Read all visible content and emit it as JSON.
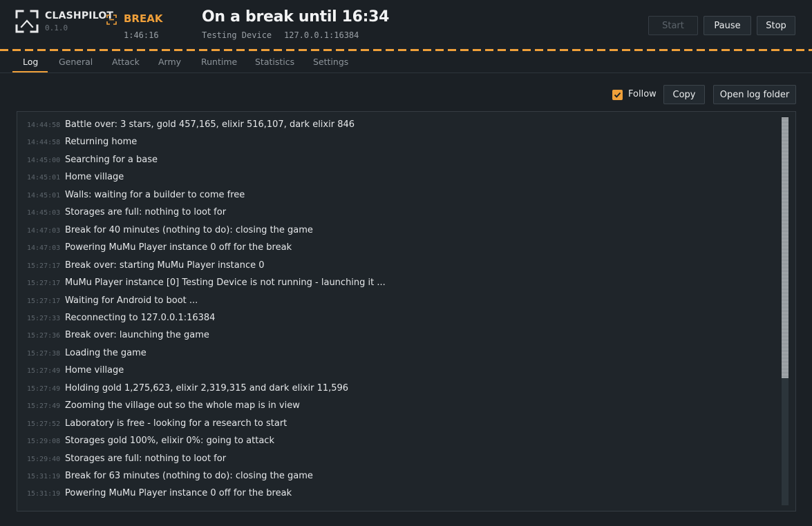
{
  "app": {
    "name": "CLASHPILOT",
    "version": "0.1.0"
  },
  "state": {
    "label": "BREAK",
    "timer": "1:46:16",
    "color": "#f0a03a"
  },
  "headline": "On a break until 16:34",
  "device": {
    "name": "Testing Device",
    "address": "127.0.0.1:16384"
  },
  "controls": {
    "start": "Start",
    "pause": "Pause",
    "stop": "Stop"
  },
  "tabs": [
    "Log",
    "General",
    "Attack",
    "Army",
    "Runtime",
    "Statistics",
    "Settings"
  ],
  "active_tab": "Log",
  "log_toolbar": {
    "follow_label": "Follow",
    "follow_checked": true,
    "copy": "Copy",
    "open_folder": "Open log folder"
  },
  "log": [
    {
      "time": "14:44:58",
      "message": "Battle over: 3 stars, gold 457,165, elixir 516,107, dark elixir 846"
    },
    {
      "time": "14:44:58",
      "message": "Returning home"
    },
    {
      "time": "14:45:00",
      "message": "Searching for a base"
    },
    {
      "time": "14:45:01",
      "message": "Home village"
    },
    {
      "time": "14:45:01",
      "message": "Walls: waiting for a builder to come free"
    },
    {
      "time": "14:45:03",
      "message": "Storages are full: nothing to loot for"
    },
    {
      "time": "14:47:03",
      "message": "Break for 40 minutes (nothing to do): closing the game"
    },
    {
      "time": "14:47:03",
      "message": "Powering MuMu Player instance 0 off for the break"
    },
    {
      "time": "15:27:17",
      "message": "Break over: starting MuMu Player instance 0"
    },
    {
      "time": "15:27:17",
      "message": "MuMu Player instance [0] Testing Device is not running - launching it ..."
    },
    {
      "time": "15:27:17",
      "message": "Waiting for Android to boot ..."
    },
    {
      "time": "15:27:33",
      "message": "Reconnecting to 127.0.0.1:16384"
    },
    {
      "time": "15:27:36",
      "message": "Break over: launching the game"
    },
    {
      "time": "15:27:38",
      "message": "Loading the game"
    },
    {
      "time": "15:27:49",
      "message": "Home village"
    },
    {
      "time": "15:27:49",
      "message": "Holding gold 1,275,623, elixir 2,319,315 and dark elixir 11,596"
    },
    {
      "time": "15:27:49",
      "message": "Zooming the village out so the whole map is in view"
    },
    {
      "time": "15:27:52",
      "message": "Laboratory is free - looking for a research to start"
    },
    {
      "time": "15:29:08",
      "message": "Storages gold 100%, elixir 0%: going to attack"
    },
    {
      "time": "15:29:40",
      "message": "Storages are full: nothing to loot for"
    },
    {
      "time": "15:31:19",
      "message": "Break for 63 minutes (nothing to do): closing the game"
    },
    {
      "time": "15:31:19",
      "message": "Powering MuMu Player instance 0 off for the break"
    }
  ],
  "accent": "#f0a03a"
}
